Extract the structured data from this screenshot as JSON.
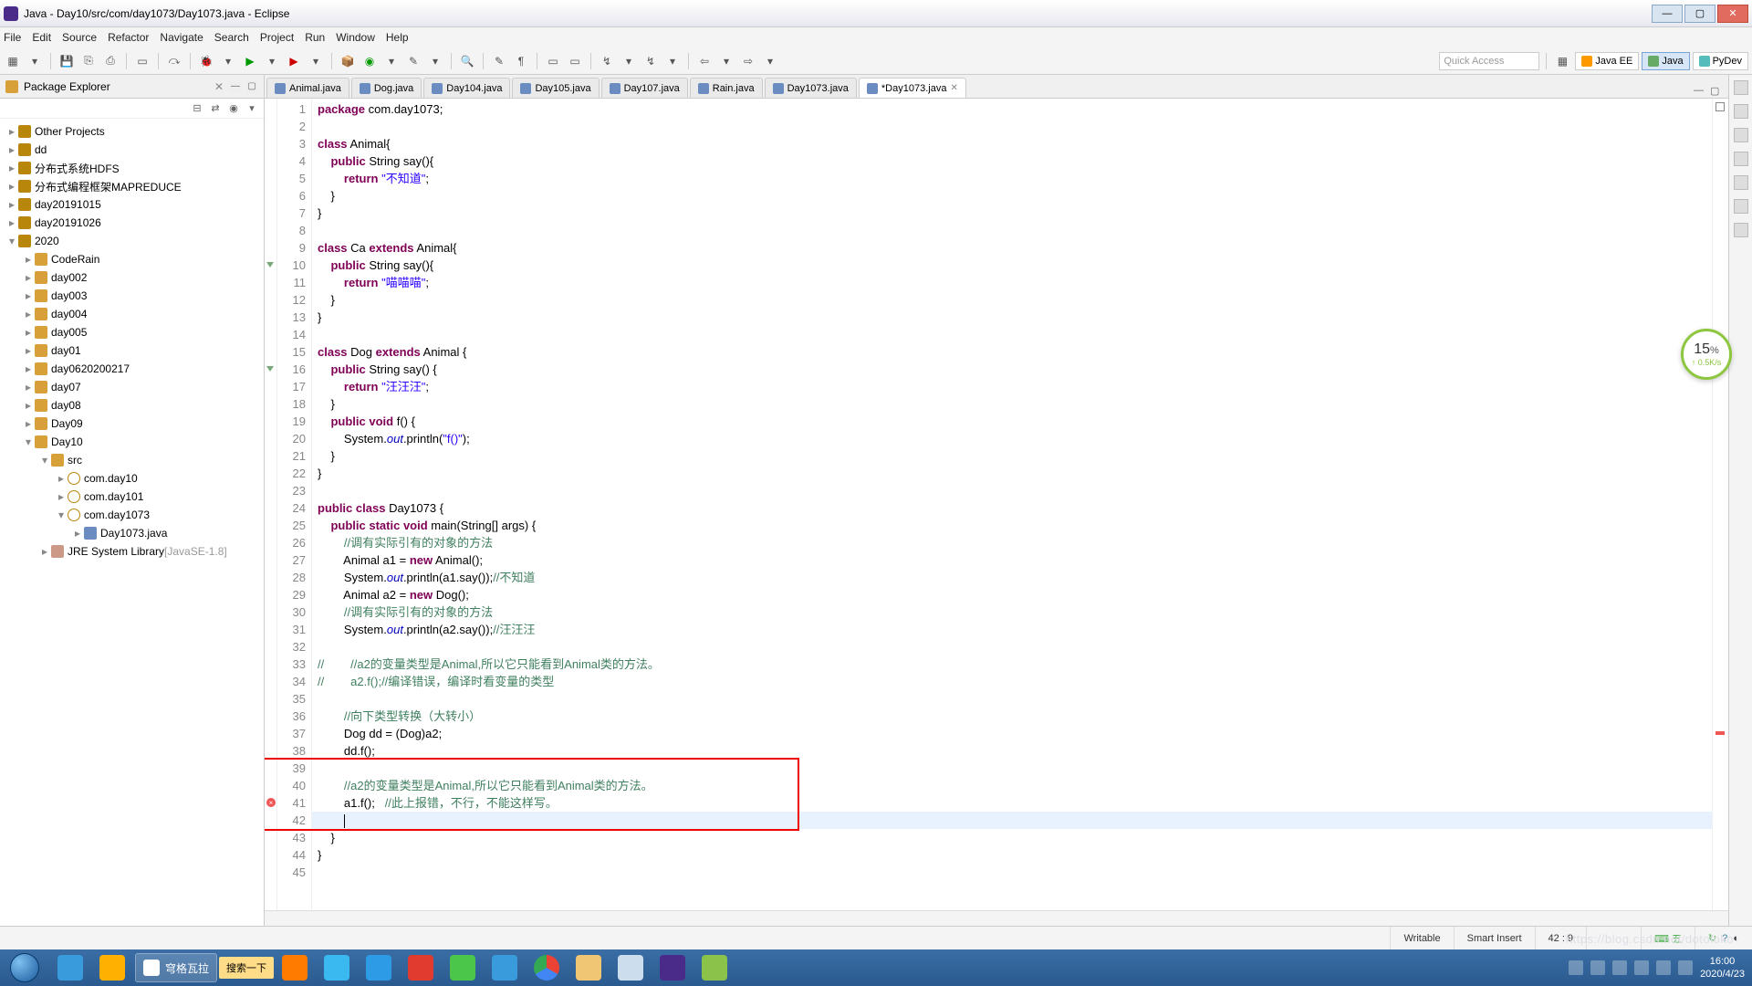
{
  "title": "Java - Day10/src/com/day1073/Day1073.java - Eclipse",
  "menus": [
    "File",
    "Edit",
    "Source",
    "Refactor",
    "Navigate",
    "Search",
    "Project",
    "Run",
    "Window",
    "Help"
  ],
  "quick_access": "Quick Access",
  "perspectives": [
    {
      "label": "Java EE",
      "cls": "jee"
    },
    {
      "label": "Java",
      "cls": "java",
      "active": true
    },
    {
      "label": "PyDev",
      "cls": "py"
    }
  ],
  "pkg_explorer": {
    "title": "Package Explorer"
  },
  "tree": [
    {
      "ind": 0,
      "tw": "▸",
      "icon": "ti-prj",
      "label": "Other Projects"
    },
    {
      "ind": 0,
      "tw": "▸",
      "icon": "ti-prj",
      "label": "dd"
    },
    {
      "ind": 0,
      "tw": "▸",
      "icon": "ti-prj",
      "label": "分布式系统HDFS"
    },
    {
      "ind": 0,
      "tw": "▸",
      "icon": "ti-prj",
      "label": "分布式编程框架MAPREDUCE"
    },
    {
      "ind": 0,
      "tw": "▸",
      "icon": "ti-prj",
      "label": "day20191015"
    },
    {
      "ind": 0,
      "tw": "▸",
      "icon": "ti-prj",
      "label": "day20191026"
    },
    {
      "ind": 0,
      "tw": "▾",
      "icon": "ti-prj",
      "label": "2020"
    },
    {
      "ind": 1,
      "tw": "▸",
      "icon": "ti-fld",
      "label": "CodeRain"
    },
    {
      "ind": 1,
      "tw": "▸",
      "icon": "ti-fld",
      "label": "day002"
    },
    {
      "ind": 1,
      "tw": "▸",
      "icon": "ti-fld",
      "label": "day003"
    },
    {
      "ind": 1,
      "tw": "▸",
      "icon": "ti-fld",
      "label": "day004"
    },
    {
      "ind": 1,
      "tw": "▸",
      "icon": "ti-fld",
      "label": "day005"
    },
    {
      "ind": 1,
      "tw": "▸",
      "icon": "ti-fld",
      "label": "day01"
    },
    {
      "ind": 1,
      "tw": "▸",
      "icon": "ti-fld",
      "label": "day0620200217"
    },
    {
      "ind": 1,
      "tw": "▸",
      "icon": "ti-fld",
      "label": "day07"
    },
    {
      "ind": 1,
      "tw": "▸",
      "icon": "ti-fld",
      "label": "day08"
    },
    {
      "ind": 1,
      "tw": "▸",
      "icon": "ti-fld",
      "label": "Day09"
    },
    {
      "ind": 1,
      "tw": "▾",
      "icon": "ti-fld",
      "label": "Day10"
    },
    {
      "ind": 2,
      "tw": "▾",
      "icon": "ti-src",
      "label": "src"
    },
    {
      "ind": 3,
      "tw": "▸",
      "icon": "ti-pkg",
      "label": "com.day10"
    },
    {
      "ind": 3,
      "tw": "▸",
      "icon": "ti-pkg",
      "label": "com.day101"
    },
    {
      "ind": 3,
      "tw": "▾",
      "icon": "ti-pkg",
      "label": "com.day1073"
    },
    {
      "ind": 4,
      "tw": "▸",
      "icon": "ti-java",
      "label": "Day1073.java"
    },
    {
      "ind": 2,
      "tw": "▸",
      "icon": "ti-lib",
      "label": "JRE System Library",
      "suffix": "[JavaSE-1.8]"
    }
  ],
  "tabs": [
    {
      "label": "Animal.java"
    },
    {
      "label": "Dog.java"
    },
    {
      "label": "Day104.java"
    },
    {
      "label": "Day105.java"
    },
    {
      "label": "Day107.java"
    },
    {
      "label": "Rain.java"
    },
    {
      "label": "Day1073.java"
    },
    {
      "label": "*Day1073.java",
      "active": true
    }
  ],
  "status": {
    "writable": "Writable",
    "insert": "Smart Insert",
    "pos": "42 : 9"
  },
  "speed": {
    "big": "15",
    "unit": "%",
    "small": "↑ 0.5K/s"
  },
  "task_running": "穹格瓦拉",
  "search_btn": "搜索一下",
  "clock": {
    "time": "16:00",
    "date": "2020/4/23"
  },
  "watermark": "https://blog.csdn.net/dotoloko",
  "code": [
    {
      "n": 1,
      "h": "<span class='kw'>package</span> com.day1073;"
    },
    {
      "n": 2,
      "h": ""
    },
    {
      "n": 3,
      "h": "<span class='kw'>class</span> Animal{"
    },
    {
      "n": 4,
      "h": "    <span class='kw'>public</span> String say(){"
    },
    {
      "n": 5,
      "h": "        <span class='kw'>return</span> <span class='str'>\"不知道\"</span>;"
    },
    {
      "n": 6,
      "h": "    }"
    },
    {
      "n": 7,
      "h": "}"
    },
    {
      "n": 8,
      "h": ""
    },
    {
      "n": 9,
      "h": "<span class='kw'>class</span> Ca <span class='kw'>extends</span> Animal{"
    },
    {
      "n": 10,
      "h": "    <span class='kw'>public</span> String say(){",
      "fold": true
    },
    {
      "n": 11,
      "h": "        <span class='kw'>return</span> <span class='str'>\"喵喵喵\"</span>;"
    },
    {
      "n": 12,
      "h": "    }"
    },
    {
      "n": 13,
      "h": "}"
    },
    {
      "n": 14,
      "h": ""
    },
    {
      "n": 15,
      "h": "<span class='kw'>class</span> Dog <span class='kw'>extends</span> Animal {"
    },
    {
      "n": 16,
      "h": "    <span class='kw'>public</span> String say() {",
      "fold": true
    },
    {
      "n": 17,
      "h": "        <span class='kw'>return</span> <span class='str'>\"汪汪汪\"</span>;"
    },
    {
      "n": 18,
      "h": "    }"
    },
    {
      "n": 19,
      "h": "    <span class='kw'>public</span> <span class='kw'>void</span> f() {"
    },
    {
      "n": 20,
      "h": "        System.<span class='fld'>out</span>.println(<span class='str'>\"f()\"</span>);"
    },
    {
      "n": 21,
      "h": "    }"
    },
    {
      "n": 22,
      "h": "}"
    },
    {
      "n": 23,
      "h": ""
    },
    {
      "n": 24,
      "h": "<span class='kw'>public</span> <span class='kw'>class</span> Day1073 {"
    },
    {
      "n": 25,
      "h": "    <span class='kw'>public</span> <span class='kw'>static</span> <span class='kw'>void</span> main(String[] args) {"
    },
    {
      "n": 26,
      "h": "        <span class='cmt'>//调有实际引有的对象的方法</span>"
    },
    {
      "n": 27,
      "h": "        Animal a1 = <span class='kw'>new</span> Animal();"
    },
    {
      "n": 28,
      "h": "        System.<span class='fld'>out</span>.println(a1.say());<span class='cmt'>//不知道</span>"
    },
    {
      "n": 29,
      "h": "        Animal a2 = <span class='kw'>new</span> Dog();"
    },
    {
      "n": 30,
      "h": "        <span class='cmt'>//调有实际引有的对象的方法</span>"
    },
    {
      "n": 31,
      "h": "        System.<span class='fld'>out</span>.println(a2.say());<span class='cmt'>//汪汪汪</span>"
    },
    {
      "n": 32,
      "h": ""
    },
    {
      "n": 33,
      "h": "<span class='cmt'>//        //a2的变量类型是Animal,所以它只能看到Animal类的方法。</span>"
    },
    {
      "n": 34,
      "h": "<span class='cmt'>//        a2.f();//编译错误，编译时看变量的类型</span>"
    },
    {
      "n": 35,
      "h": ""
    },
    {
      "n": 36,
      "h": "        <span class='cmt'>//向下类型转换（大转小）</span>"
    },
    {
      "n": 37,
      "h": "        Dog dd = (Dog)a2;"
    },
    {
      "n": 38,
      "h": "        dd.f();"
    },
    {
      "n": 39,
      "h": ""
    },
    {
      "n": 40,
      "h": "        <span class='cmt'>//a2的变量类型是Animal,所以它只能看到Animal类的方法。</span>"
    },
    {
      "n": 41,
      "h": "        a1.f();   <span class='cmt'>//此上报错，不行，不能这样写。</span>",
      "err": true
    },
    {
      "n": 42,
      "h": "        ",
      "cur": true
    },
    {
      "n": 43,
      "h": "    }"
    },
    {
      "n": 44,
      "h": "}"
    },
    {
      "n": 45,
      "h": ""
    }
  ],
  "redbox_lines": [
    39,
    42
  ]
}
